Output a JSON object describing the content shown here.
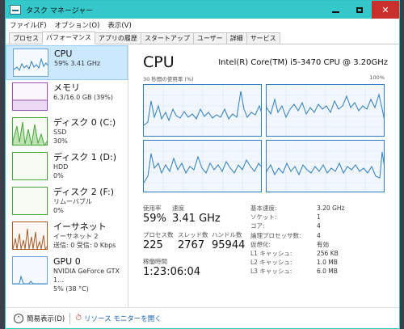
{
  "window": {
    "title": "タスク マネージャー",
    "controls": {
      "minimize": "minimize",
      "maximize": "maximize",
      "close": "✕"
    }
  },
  "menu": [
    "ファイル(F)",
    "オプション(O)",
    "表示(V)"
  ],
  "tabs": [
    "プロセス",
    "パフォーマンス",
    "アプリの履歴",
    "スタートアップ",
    "ユーザー",
    "詳細",
    "サービス"
  ],
  "active_tab": "パフォーマンス",
  "sidebar": [
    {
      "name": "CPU",
      "line1": "59% 3.41 GHz",
      "line2": "",
      "kind": "cpu",
      "active": true
    },
    {
      "name": "メモリ",
      "line1": "6.3/16.0 GB (39%)",
      "line2": "",
      "kind": "mem",
      "active": false
    },
    {
      "name": "ディスク 0 (C:)",
      "line1": "SSD",
      "line2": "30%",
      "kind": "disk",
      "active": false
    },
    {
      "name": "ディスク 1 (D:)",
      "line1": "HDD",
      "line2": "0%",
      "kind": "disk",
      "active": false
    },
    {
      "name": "ディスク 2 (F:)",
      "line1": "リムーバブル",
      "line2": "0%",
      "kind": "disk",
      "active": false
    },
    {
      "name": "イーサネット",
      "line1": "イーサネット 2",
      "line2": "送信: 0 受信: 0 Kbps",
      "kind": "eth",
      "active": false
    },
    {
      "name": "GPU 0",
      "line1": "NVIDIA GeForce GTX 1…",
      "line2": "5% (38 °C)",
      "kind": "gpu",
      "active": false
    }
  ],
  "main": {
    "title": "CPU",
    "model": "Intel(R) Core(TM) i5-3470 CPU @ 3.20GHz",
    "graph_caption_left": "30 秒間の使用率 (%)",
    "graph_caption_right": "100%"
  },
  "stats": {
    "usage_label": "使用率",
    "usage_value": "59%",
    "speed_label": "速度",
    "speed_value": "3.41 GHz",
    "processes_label": "プロセス数",
    "processes_value": "225",
    "threads_label": "スレッド数",
    "threads_value": "2767",
    "handles_label": "ハンドル数",
    "handles_value": "95944",
    "uptime_label": "稼働時間",
    "uptime_value": "1:23:06:04"
  },
  "specs": [
    {
      "key": "基本速度:",
      "value": "3.20 GHz"
    },
    {
      "key": "ソケット:",
      "value": "1"
    },
    {
      "key": "コア:",
      "value": "4"
    },
    {
      "key": "論理プロセッサ数:",
      "value": "4"
    },
    {
      "key": "仮想化:",
      "value": "有効"
    },
    {
      "key": "L1 キャッシュ:",
      "value": "256 KB"
    },
    {
      "key": "L2 キャッシュ:",
      "value": "1.0 MB"
    },
    {
      "key": "L3 キャッシュ:",
      "value": "6.0 MB"
    }
  ],
  "footer": {
    "fewer_details": "簡易表示(D)",
    "resource_monitor": "リソース モニターを開く"
  },
  "colors": {
    "titlebar": "#34c8cb",
    "cpu_line": "#2f7dc0",
    "close": "#c9302c"
  }
}
